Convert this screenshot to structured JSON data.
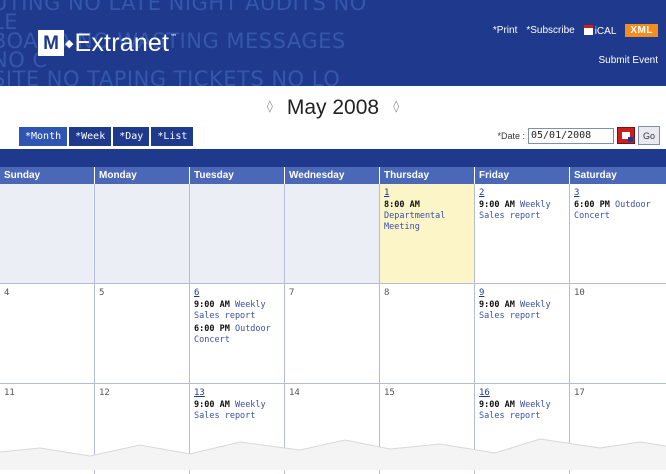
{
  "banner": {
    "watermark": "UTING NO LATE NIGHT AUDITS NO LE\nBOARD NO WASTING MESSAGES NO C\nSITE NO TAPING TICKETS NO LO\nNG NO PROCESS MADNESS",
    "logo_letter": "M",
    "logo_text": "Extranet",
    "logo_tm": "™",
    "links": {
      "print": "*Print",
      "subscribe": "*Subscribe",
      "ical": "iCAL",
      "xml": "XML",
      "submit": "Submit Event"
    }
  },
  "title": {
    "month": "May 2008",
    "prev_arrow": "◊",
    "next_arrow": "◊"
  },
  "view_tabs": [
    "*Month",
    "*Week",
    "*Day",
    "*List"
  ],
  "date_picker": {
    "label": "*Date :",
    "value": "05/01/2008",
    "go": "Go"
  },
  "day_headers": [
    "Sunday",
    "Monday",
    "Tuesday",
    "Wednesday",
    "Thursday",
    "Friday",
    "Saturday"
  ],
  "weeks": [
    [
      {
        "day": "",
        "blank": true,
        "events": []
      },
      {
        "day": "",
        "blank": true,
        "events": []
      },
      {
        "day": "",
        "blank": true,
        "events": []
      },
      {
        "day": "",
        "blank": true,
        "events": []
      },
      {
        "day": "1",
        "link": true,
        "today": true,
        "events": [
          {
            "time": "8:00 AM",
            "title": "Departmental Meeting"
          }
        ]
      },
      {
        "day": "2",
        "link": true,
        "events": [
          {
            "time": "9:00 AM",
            "title": "Weekly Sales report"
          }
        ]
      },
      {
        "day": "3",
        "link": true,
        "events": [
          {
            "time": "6:00 PM",
            "title": "Outdoor Concert"
          }
        ]
      }
    ],
    [
      {
        "day": "4",
        "events": []
      },
      {
        "day": "5",
        "events": []
      },
      {
        "day": "6",
        "link": true,
        "events": [
          {
            "time": "9:00 AM",
            "title": "Weekly Sales report"
          },
          {
            "time": "6:00 PM",
            "title": "Outdoor Concert"
          }
        ]
      },
      {
        "day": "7",
        "events": []
      },
      {
        "day": "8",
        "events": []
      },
      {
        "day": "9",
        "link": true,
        "events": [
          {
            "time": "9:00 AM",
            "title": "Weekly Sales report"
          }
        ]
      },
      {
        "day": "10",
        "events": []
      }
    ],
    [
      {
        "day": "11",
        "events": []
      },
      {
        "day": "12",
        "events": []
      },
      {
        "day": "13",
        "link": true,
        "events": [
          {
            "time": "9:00 AM",
            "title": "Weekly Sales report"
          }
        ]
      },
      {
        "day": "14",
        "events": []
      },
      {
        "day": "15",
        "events": []
      },
      {
        "day": "16",
        "link": true,
        "events": [
          {
            "time": "9:00 AM",
            "title": "Weekly Sales report"
          }
        ]
      },
      {
        "day": "17",
        "events": []
      }
    ]
  ],
  "colors": {
    "brand_blue": "#1f3a8c",
    "header_blue": "#4a67b8",
    "today_bg": "#fbf5c8",
    "xml_orange": "#f28d1e"
  }
}
